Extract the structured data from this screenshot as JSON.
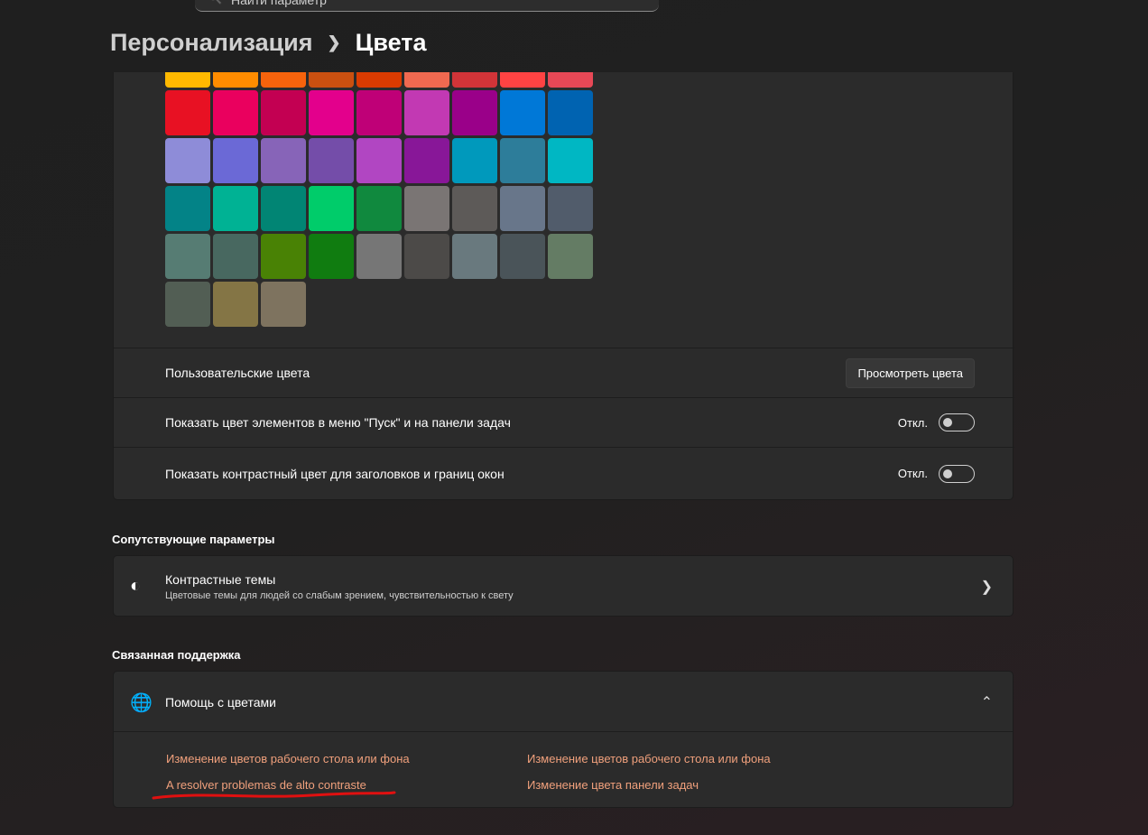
{
  "search": {
    "placeholder": "Найти параметр"
  },
  "breadcrumb": {
    "parent": "Персонализация",
    "current": "Цвета"
  },
  "swatches": [
    "#FFB900",
    "#FF8C00",
    "#F7630C",
    "#CA5010",
    "#DA3B01",
    "#EF6950",
    "#D13438",
    "#FF4343",
    "#E74856",
    "#E81123",
    "#EA005E",
    "#C30052",
    "#E3008C",
    "#BF0077",
    "#C239B3",
    "#9A0089",
    "#0078D7",
    "#0063B1",
    "#8E8CD8",
    "#6B69D6",
    "#8764B8",
    "#744DA9",
    "#B146C2",
    "#881798",
    "#0099BC",
    "#2D7D9A",
    "#00B7C3",
    "#038387",
    "#00B294",
    "#018574",
    "#00CC6A",
    "#10893E",
    "#7A7574",
    "#5D5A58",
    "#68768A",
    "#515C6B",
    "#567C73",
    "#486860",
    "#498205",
    "#107C10",
    "#767676",
    "#4C4A48",
    "#69797E",
    "#4A5459",
    "#647C64",
    "#525E54",
    "#847545",
    "#7E735F"
  ],
  "custom": {
    "label": "Пользовательские цвета",
    "button": "Просмотреть цвета"
  },
  "start_toggle": {
    "label": "Показать цвет элементов в меню \"Пуск\" и на панели задач",
    "state": "Откл."
  },
  "title_toggle": {
    "label": "Показать контрастный цвет для заголовков и границ окон",
    "state": "Откл."
  },
  "related": {
    "heading": "Сопутствующие параметры",
    "title": "Контрастные темы",
    "subtitle": "Цветовые темы для людей со слабым зрением, чувствительностью к свету"
  },
  "support": {
    "heading": "Связанная поддержка",
    "title": "Помощь с цветами",
    "links": [
      "Изменение цветов рабочего стола или фона",
      "A resolver problemas de alto contraste",
      "Изменение цветов рабочего стола или фона",
      "Изменение цвета панели задач"
    ]
  },
  "annotation_color": "#e01010"
}
